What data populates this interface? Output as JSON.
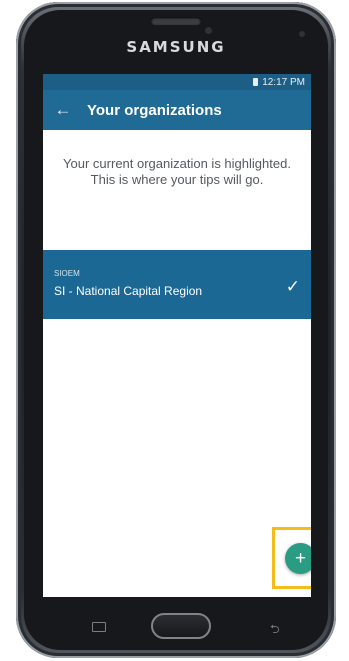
{
  "device": {
    "brand": "SAMSUNG"
  },
  "status_bar": {
    "time": "12:17 PM"
  },
  "app_bar": {
    "back_icon": "arrow-left-icon",
    "title": "Your organizations"
  },
  "info_text": "Your current organization is highlighted. This is where your tips will go.",
  "organizations": [
    {
      "code": "SIOEM",
      "name": "SI - National Capital Region",
      "selected": true
    }
  ],
  "fab": {
    "label": "+",
    "icon": "plus-icon",
    "color": "#2b9c84",
    "highlight_color": "#f4bd1c"
  },
  "colors": {
    "app_bar": "#1f6b96",
    "status_bar": "#1c5e85",
    "selected_row": "#1c6894"
  }
}
